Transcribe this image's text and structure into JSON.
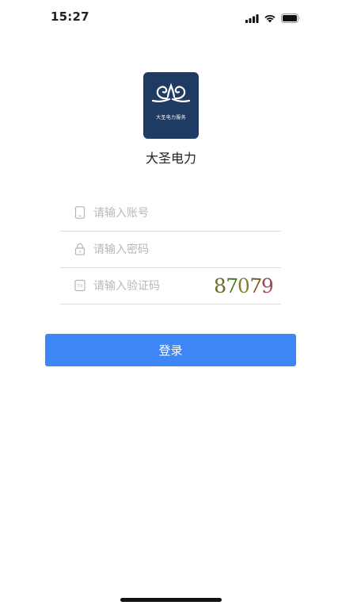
{
  "status_bar": {
    "time": "15:27"
  },
  "app": {
    "name": "大圣电力",
    "logo_caption": "大圣电力服务",
    "logo_color": "#1f3a63"
  },
  "form": {
    "account": {
      "placeholder": "请输入账号",
      "value": "",
      "icon": "phone-icon"
    },
    "password": {
      "placeholder": "请输入密码",
      "value": "",
      "icon": "lock-icon"
    },
    "captcha": {
      "placeholder": "请输入验证码",
      "value": "",
      "icon": "captcha-icon",
      "code": "87079"
    },
    "login_label": "登录"
  },
  "colors": {
    "primary": "#3e86f5",
    "placeholder": "#b8b8b8",
    "divider": "#dcdcdc"
  }
}
